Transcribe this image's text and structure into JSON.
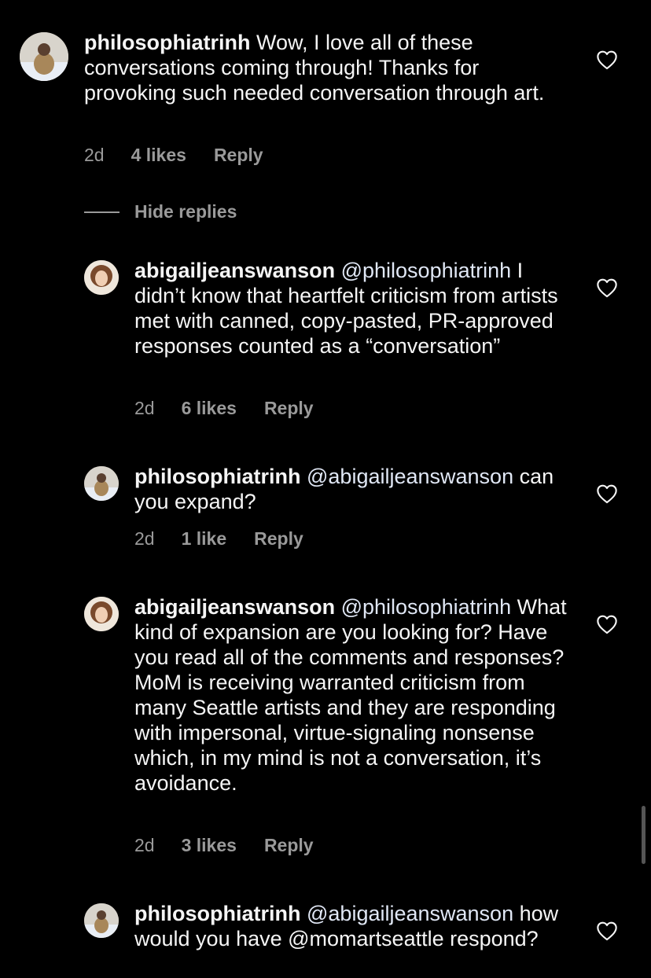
{
  "comments": [
    {
      "username": "philosophiatrinh",
      "mention": "",
      "text": "Wow, I love all of these conversations coming through! Thanks for provoking such needed conversation through art.",
      "time": "2d",
      "likes": "4 likes",
      "reply": "Reply",
      "avatar": "philosophia"
    },
    {
      "username": "abigailjeanswanson",
      "mention": "@philosophiatrinh",
      "text": "I didn’t know that heartfelt criticism from artists met with canned, copy-pasted, PR-approved responses counted as a “conversation”",
      "time": "2d",
      "likes": "6 likes",
      "reply": "Reply",
      "avatar": "abigail"
    },
    {
      "username": "philosophiatrinh",
      "mention": "@abigailjeanswanson",
      "text": "can you expand?",
      "time": "2d",
      "likes": "1 like",
      "reply": "Reply",
      "avatar": "philosophia"
    },
    {
      "username": "abigailjeanswanson",
      "mention": "@philosophiatrinh",
      "text": "What kind of expansion are you looking for? Have you read all of the comments and responses? MoM is receiving warranted criticism from many Seattle artists and they are responding with impersonal, virtue-signaling nonsense which, in my mind is not a conversation, it’s avoidance.",
      "time": "2d",
      "likes": "3 likes",
      "reply": "Reply",
      "avatar": "abigail"
    },
    {
      "username": "philosophiatrinh",
      "mention": "@abigailjeanswanson",
      "text": "how would you have @momartseattle respond?",
      "time": "",
      "likes": "",
      "reply": "",
      "avatar": "philosophia"
    }
  ],
  "hide_replies": "Hide replies",
  "icons": {
    "like": "heart-outline-icon"
  }
}
